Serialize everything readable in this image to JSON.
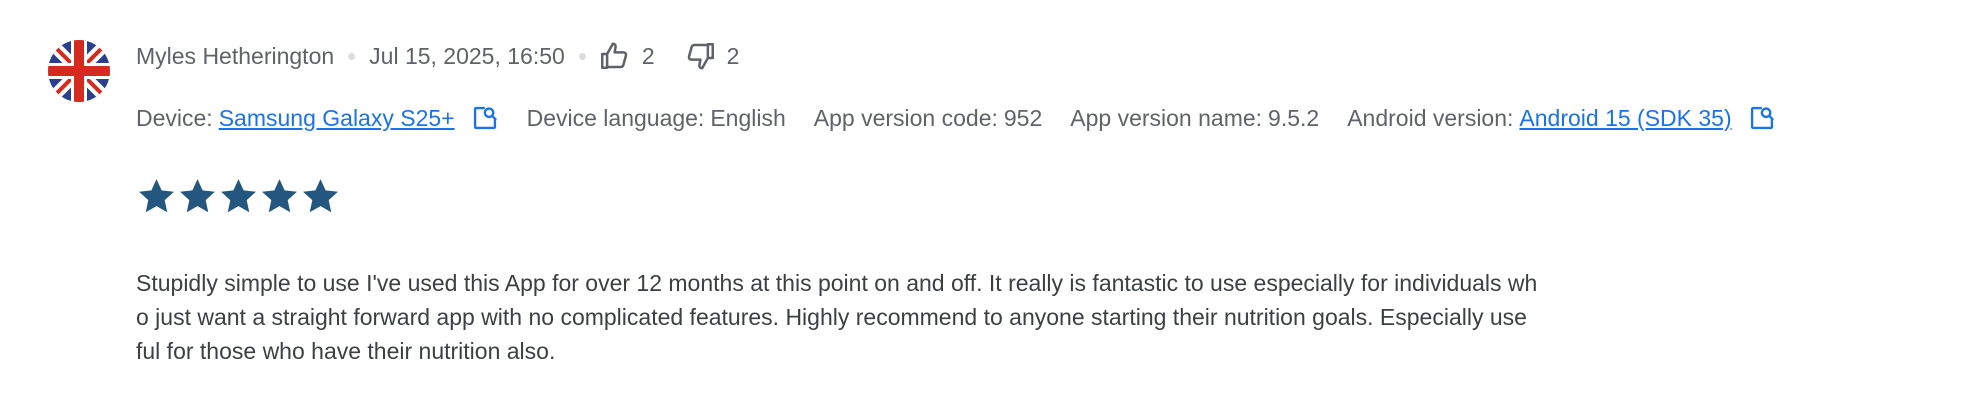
{
  "review": {
    "author": "Myles Hetherington",
    "date": "Jul 15, 2025, 16:50",
    "thumbs_up_count": "2",
    "thumbs_down_count": "2",
    "avatar_icon": "uk-flag",
    "rating": 5,
    "rating_max": 5,
    "text_lines": [
      "Stupidly simple to use I've used this App for over 12 months at this point on and off. It really is fantastic to use especially for individuals wh",
      "o just want a straight forward app with no complicated features. Highly recommend to anyone starting their nutrition goals. Especially use",
      "ful for those who have their nutrition also."
    ]
  },
  "meta": {
    "device_label": "Device:",
    "device_value": "Samsung Galaxy S25+",
    "language_label": "Device language:",
    "language_value": "English",
    "version_code_label": "App version code:",
    "version_code_value": "952",
    "version_name_label": "App version name:",
    "version_name_value": "9.5.2",
    "android_label": "Android version:",
    "android_value": "Android 15 (SDK 35)"
  },
  "colors": {
    "star": "#24577f",
    "link": "#1a73e8",
    "muted_text": "#5f6368",
    "body_text": "#3c4043"
  }
}
